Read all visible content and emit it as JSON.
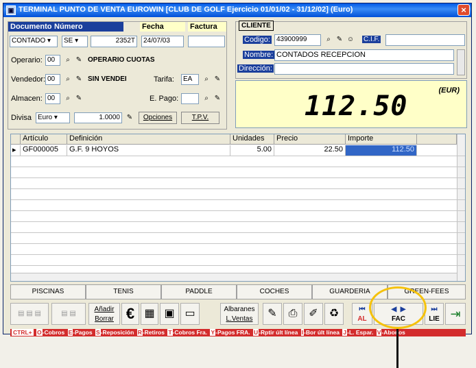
{
  "window": {
    "title": "TERMINAL PUNTO DE VENTA EUROWIN  [CLUB DE GOLF Ejercicio 01/01/02 - 31/12/02] (Euro)"
  },
  "header": {
    "documento_label": "Documento",
    "numero_label": "Número",
    "fecha_label": "Fecha",
    "factura_label": "Factura",
    "documento_value": "CONTADO",
    "serie_value": "SE",
    "numero_value": "2352T",
    "fecha_value": "24/07/03",
    "factura_value": "",
    "operario_label": "Operario:",
    "operario_value": "00",
    "operario_name": "OPERARIO CUOTAS",
    "vendedor_label": "Vendedor:",
    "vendedor_value": "00",
    "vendedor_name": "SIN VENDEI",
    "tarifa_label": "Tarifa:",
    "tarifa_value": "EA",
    "almacen_label": "Almacen:",
    "almacen_value": "00",
    "epago_label": "E. Pago:",
    "epago_value": "",
    "divisa_label": "Divisa",
    "divisa_value": "Euro",
    "cambio_value": "1.0000",
    "opciones_label": "Opciones",
    "tpv_label": "T.P.V."
  },
  "cliente": {
    "title": "CLIENTE",
    "codigo_label": "Codigo:",
    "codigo_value": "43900999",
    "cif_label": "C.I.F.",
    "cif_value": "",
    "nombre_label": "Nombre:",
    "nombre_value": "CONTADOS RECEPCION",
    "direccion_label": "Dirección:",
    "direccion_value": ""
  },
  "display": {
    "amount": "112.50",
    "currency": "(EUR)"
  },
  "grid": {
    "columns": [
      "Artículo",
      "Definición",
      "Unidades",
      "Precio",
      "Importe"
    ],
    "rows": [
      {
        "articulo": "GF000005",
        "definicion": "G.F. 9 HOYOS",
        "unidades": "5.00",
        "precio": "22.50",
        "importe": "112.50"
      }
    ]
  },
  "tabs": [
    "PISCINAS",
    "TENIS",
    "PADDLE",
    "COCHES",
    "GUARDERIA",
    "GREEN-FEES"
  ],
  "toolbar": {
    "anadir_label": "Añadir",
    "borrar_label": "Borrar",
    "euro_symbol": "€",
    "albaranes_label": "Albaranes",
    "lventas_label": "L.Ventas",
    "al_label": "AL",
    "fac_label": "FAC",
    "lie_label": "LIE"
  },
  "statusbar": {
    "prefix": "CTRL+",
    "items": [
      {
        "key": "O",
        "text": "-Cobros"
      },
      {
        "key": "E",
        "text": "-Pagos"
      },
      {
        "key": "S",
        "text": "-Reposición"
      },
      {
        "key": "R",
        "text": "-Retiros"
      },
      {
        "key": "T",
        "text": "-Cobros Fra."
      },
      {
        "key": "Y",
        "text": "-Pagos FRA."
      },
      {
        "key": "U",
        "text": "-Rptir últ línea"
      },
      {
        "key": "I",
        "text": "-Bor últ línea"
      },
      {
        "key": "J",
        "text": "-L. Espar."
      },
      {
        "key": "V",
        "text": "-Abonos"
      }
    ]
  },
  "colors": {
    "title_blue": "#0058e6",
    "status_red": "#d32c2c",
    "display_yellow": "#ffffc8",
    "highlight_circle": "#f5c20c"
  }
}
